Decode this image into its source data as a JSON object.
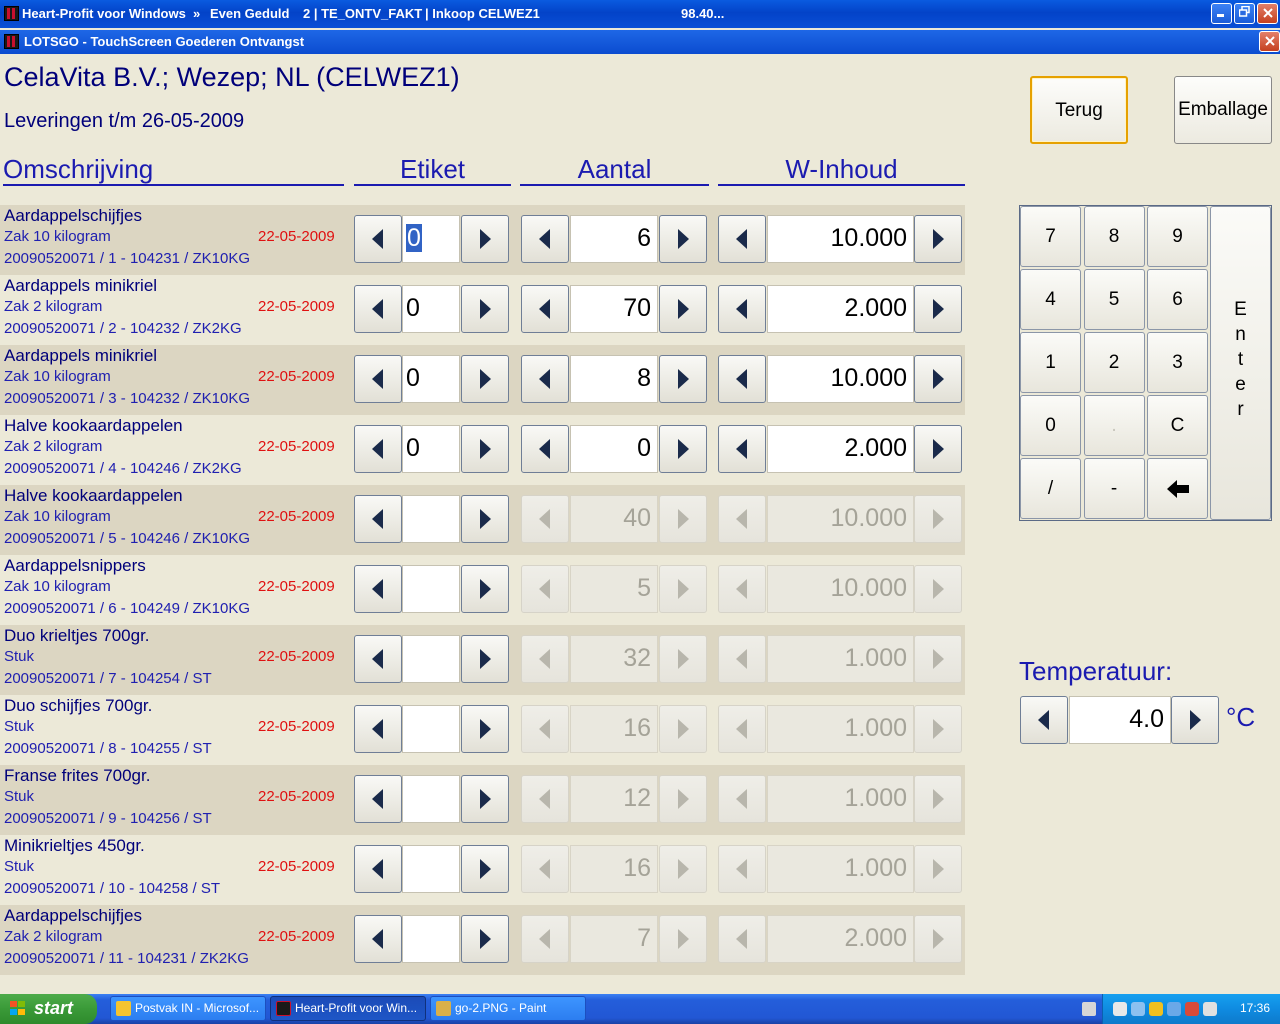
{
  "window": {
    "title_app": "Heart-Profit voor Windows",
    "title_sep": "»",
    "title_user": "Even Geduld",
    "title_module": "2 | TE_ONTV_FAKT",
    "title_context": "| Inkoop CELWEZ1",
    "title_version": "98.40...",
    "subtitle": "LOTSGO - TouchScreen Goederen Ontvangst"
  },
  "header": {
    "supplier": "CelaVita B.V.; Wezep; NL (CELWEZ1)",
    "deliveries": "Leveringen t/m 26-05-2009"
  },
  "buttons": {
    "back": "Terug",
    "packaging": "Emballage"
  },
  "columns": {
    "description": "Omschrijving",
    "label": "Etiket",
    "quantity": "Aantal",
    "content": "W-Inhoud"
  },
  "rows": [
    {
      "name": "Aardappelschijfjes",
      "unit": "Zak 10 kilogram",
      "date": "22-05-2009",
      "code": "20090520071 / 1 - 104231 / ZK10KG",
      "etiket": "0",
      "aantal": "6",
      "inhoud": "10.000",
      "enabled": true
    },
    {
      "name": "Aardappels minikriel",
      "unit": "Zak 2 kilogram",
      "date": "22-05-2009",
      "code": "20090520071 / 2 - 104232 / ZK2KG",
      "etiket": "0",
      "aantal": "70",
      "inhoud": "2.000",
      "enabled": true
    },
    {
      "name": "Aardappels minikriel",
      "unit": "Zak 10 kilogram",
      "date": "22-05-2009",
      "code": "20090520071 / 3 - 104232 / ZK10KG",
      "etiket": "0",
      "aantal": "8",
      "inhoud": "10.000",
      "enabled": true
    },
    {
      "name": "Halve kookaardappelen",
      "unit": "Zak 2 kilogram",
      "date": "22-05-2009",
      "code": "20090520071 / 4 - 104246 / ZK2KG",
      "etiket": "0",
      "aantal": "0",
      "inhoud": "2.000",
      "enabled": true
    },
    {
      "name": "Halve kookaardappelen",
      "unit": "Zak 10 kilogram",
      "date": "22-05-2009",
      "code": "20090520071 / 5 - 104246 / ZK10KG",
      "etiket": "",
      "aantal": "40",
      "inhoud": "10.000",
      "enabled": false
    },
    {
      "name": "Aardappelsnippers",
      "unit": "Zak 10 kilogram",
      "date": "22-05-2009",
      "code": "20090520071 / 6 - 104249 / ZK10KG",
      "etiket": "",
      "aantal": "5",
      "inhoud": "10.000",
      "enabled": false
    },
    {
      "name": "Duo krieltjes 700gr.",
      "unit": "Stuk",
      "date": "22-05-2009",
      "code": "20090520071 / 7 - 104254 / ST",
      "etiket": "",
      "aantal": "32",
      "inhoud": "1.000",
      "enabled": false
    },
    {
      "name": "Duo schijfjes 700gr.",
      "unit": "Stuk",
      "date": "22-05-2009",
      "code": "20090520071 / 8 - 104255 / ST",
      "etiket": "",
      "aantal": "16",
      "inhoud": "1.000",
      "enabled": false
    },
    {
      "name": "Franse frites 700gr.",
      "unit": "Stuk",
      "date": "22-05-2009",
      "code": "20090520071 / 9 - 104256 / ST",
      "etiket": "",
      "aantal": "12",
      "inhoud": "1.000",
      "enabled": false
    },
    {
      "name": "Minikrieltjes 450gr.",
      "unit": "Stuk",
      "date": "22-05-2009",
      "code": "20090520071 / 10 - 104258 / ST",
      "etiket": "",
      "aantal": "16",
      "inhoud": "1.000",
      "enabled": false
    },
    {
      "name": "Aardappelschijfjes",
      "unit": "Zak 2 kilogram",
      "date": "22-05-2009",
      "code": "20090520071 / 11 - 104231 / ZK2KG",
      "etiket": "",
      "aantal": "7",
      "inhoud": "2.000",
      "enabled": false
    }
  ],
  "keypad": {
    "keys": [
      "7",
      "8",
      "9",
      "4",
      "5",
      "6",
      "1",
      "2",
      "3",
      "0",
      ".",
      "C",
      "/",
      "-",
      "backspace-icon"
    ],
    "enter": [
      "E",
      "n",
      "t",
      "e",
      "r"
    ]
  },
  "temperature": {
    "label": "Temperatuur:",
    "value": "4.0",
    "unit": "°C"
  },
  "taskbar": {
    "start": "start",
    "items": [
      {
        "label": "Postvak IN - Microsof...",
        "active": false
      },
      {
        "label": "Heart-Profit voor Win...",
        "active": true
      },
      {
        "label": "go-2.PNG - Paint",
        "active": false
      }
    ],
    "clock": "17:36"
  }
}
